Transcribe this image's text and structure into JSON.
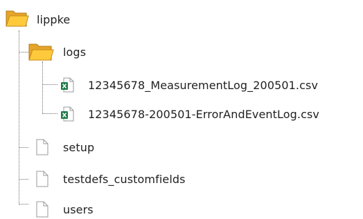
{
  "tree": {
    "root": {
      "label": "lippke",
      "icon": "folder-open-icon"
    },
    "logs": {
      "label": "logs",
      "icon": "folder-open-icon"
    },
    "files": [
      {
        "label": "12345678_MeasurementLog_200501.csv",
        "icon": "excel-csv-file-icon"
      },
      {
        "label": "12345678-200501-ErrorAndEventLog.csv",
        "icon": "excel-csv-file-icon"
      },
      {
        "label": "setup",
        "icon": "blank-file-icon"
      },
      {
        "label": "testdefs_customfields",
        "icon": "blank-file-icon"
      },
      {
        "label": "users",
        "icon": "blank-file-icon"
      }
    ]
  },
  "colors": {
    "folder_back": "#e6a52a",
    "folder_front": "#ffc93c",
    "excel_green": "#1d7a45",
    "connector": "#6a6a6a"
  }
}
